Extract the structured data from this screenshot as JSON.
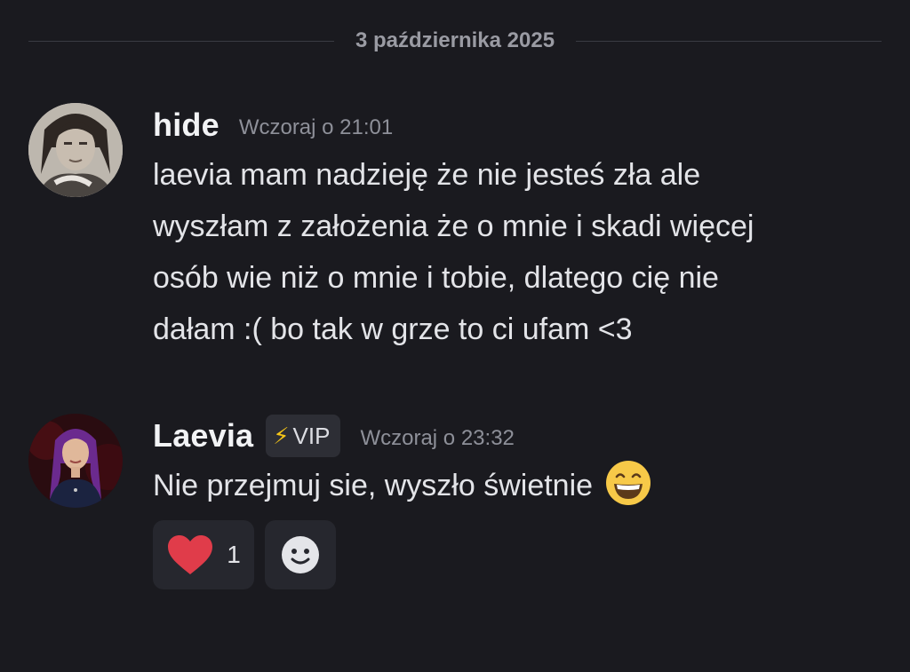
{
  "date_divider": {
    "label": "3 października 2025"
  },
  "messages": [
    {
      "username": "hide",
      "timestamp": "Wczoraj o 21:01",
      "avatar_icon": "hide-avatar",
      "lines": [
        "laevia mam nadzieję że nie jesteś zła ale",
        "wyszłam z założenia że o mnie i skadi więcej",
        "osób wie niż o mnie i tobie, dlatego cię nie",
        "dałam :( bo tak w grze to ci ufam <3"
      ]
    },
    {
      "username": "Laevia",
      "badge": {
        "icon": "lightning-bolt-icon",
        "text": "VIP"
      },
      "timestamp": "Wczoraj o 23:32",
      "avatar_icon": "laevia-avatar",
      "text": "Nie przejmuj sie, wyszło świetnie",
      "emoji": "grinning-face-emoji",
      "reactions": [
        {
          "icon": "heart-icon",
          "count": "1"
        },
        {
          "icon": "add-reaction-icon"
        }
      ]
    }
  ],
  "colors": {
    "background": "#1a1a1f",
    "username": "#f2f3f5",
    "timestamp": "#8e9099",
    "message_text": "#e3e4e8",
    "reaction_bg": "#26272e",
    "badge_bg": "#2d2e35",
    "heart": "#e03c4a",
    "vip_bolt": "#f5c518"
  }
}
